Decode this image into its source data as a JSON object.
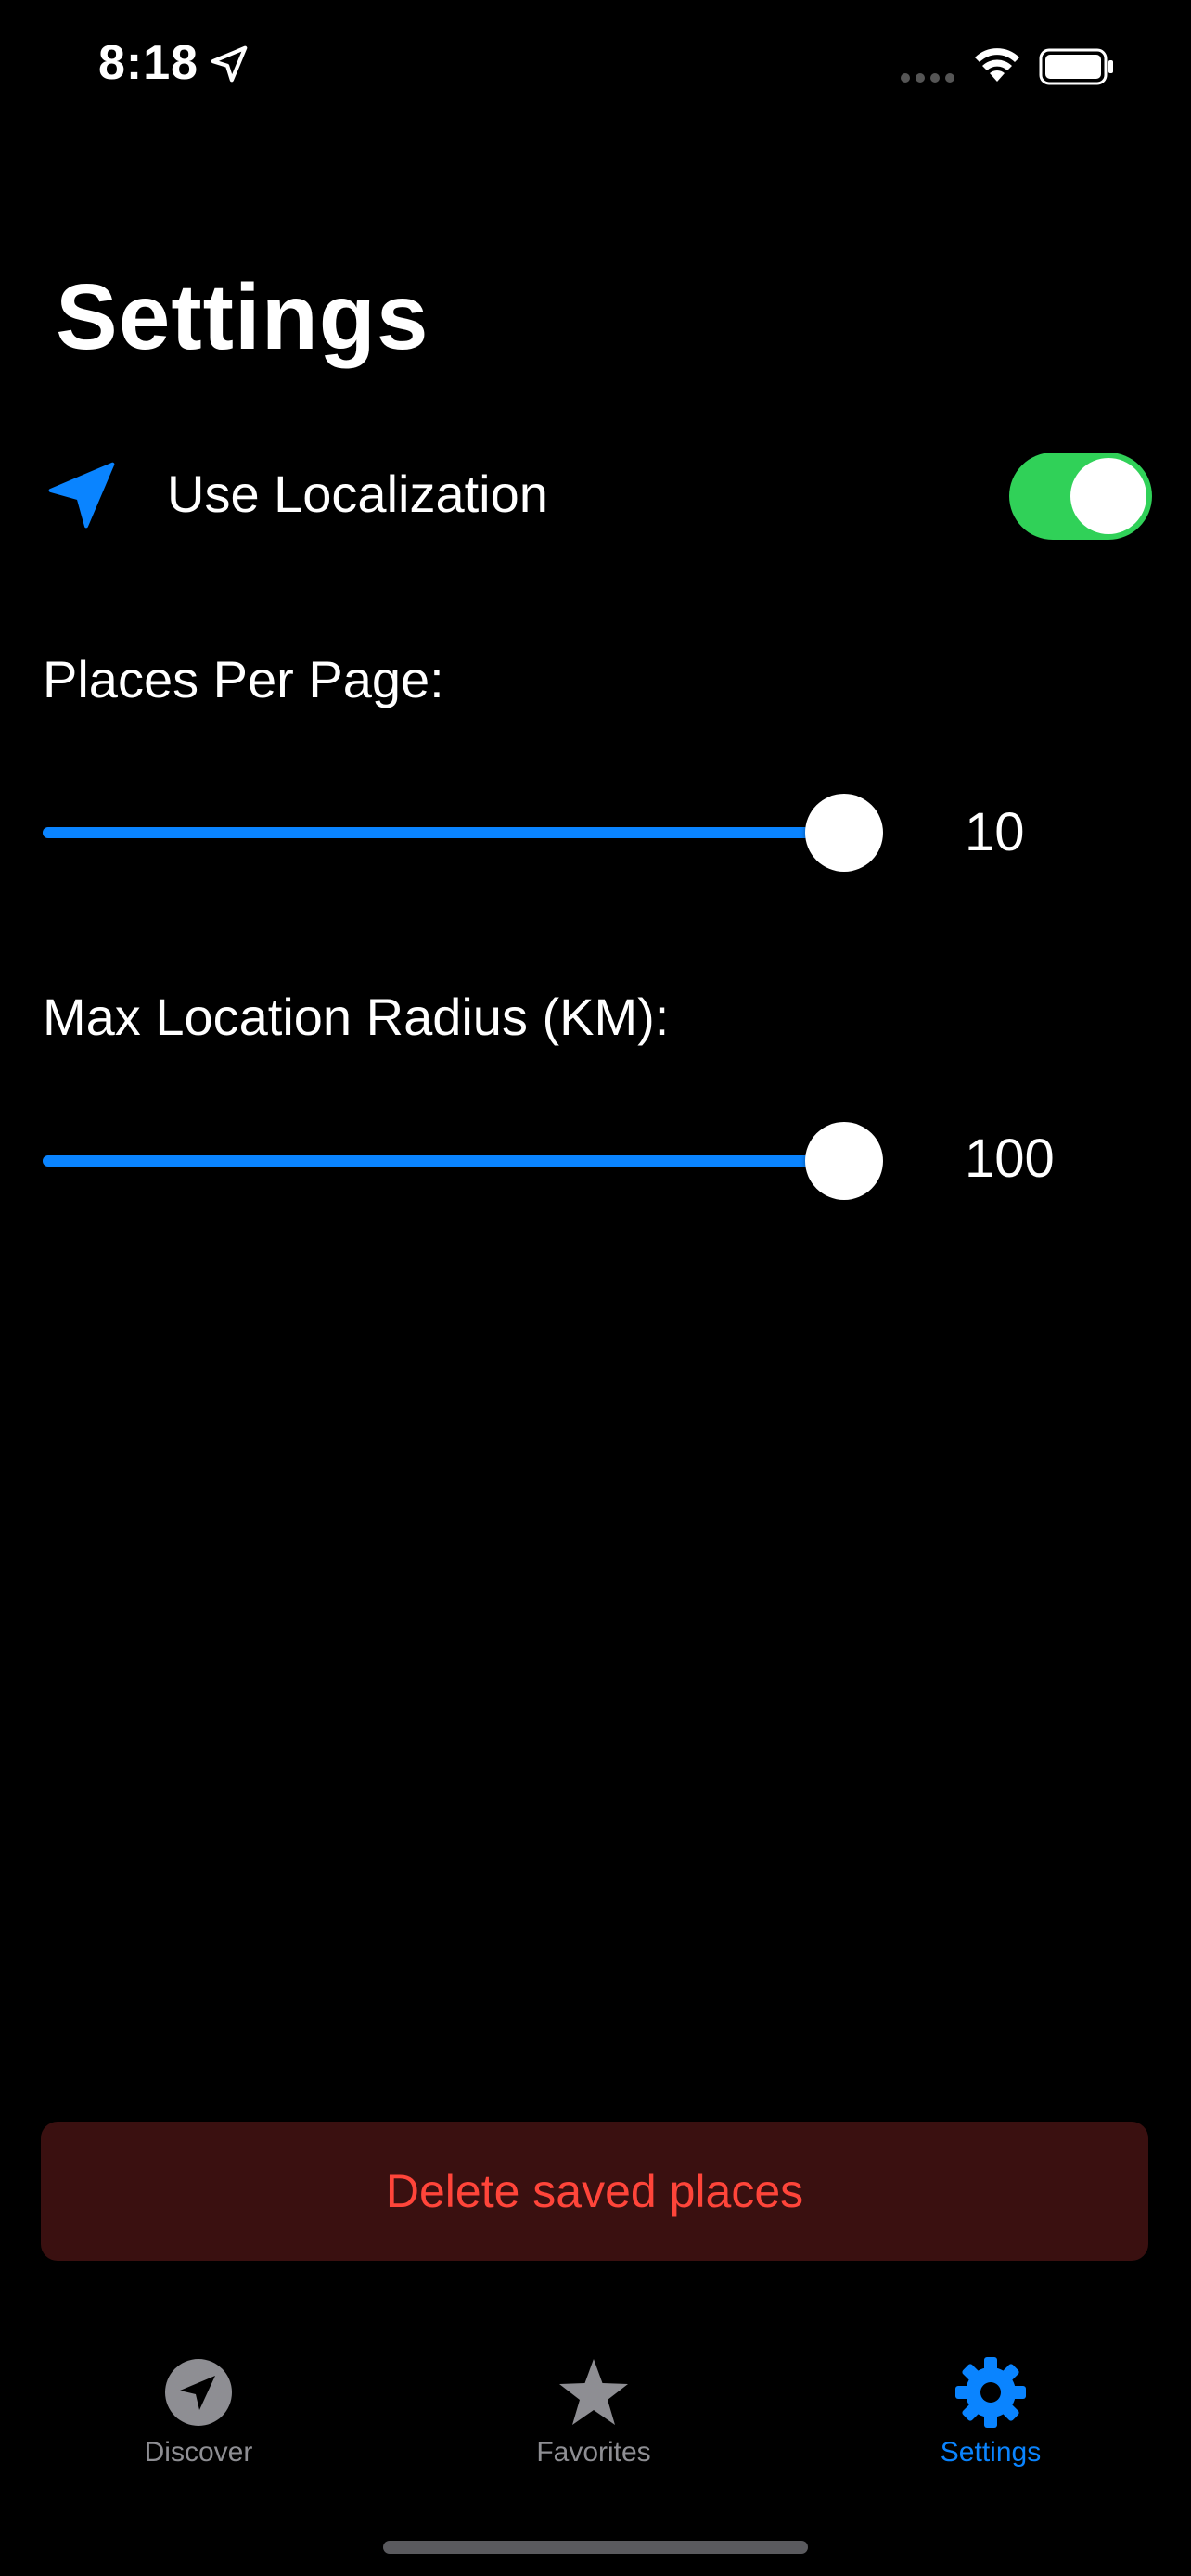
{
  "status_bar": {
    "time": "8:18",
    "location_icon": "location-arrow-outline-icon",
    "signal_icon": "cellular-dots-icon",
    "wifi_icon": "wifi-icon",
    "battery_icon": "battery-full-icon"
  },
  "page": {
    "title": "Settings"
  },
  "localization": {
    "icon": "location-arrow-fill-icon",
    "label": "Use Localization",
    "enabled": true
  },
  "places_per_page": {
    "label": "Places Per Page:",
    "value": "10",
    "fill_fraction": 0.96
  },
  "max_radius": {
    "label": "Max Location Radius (KM):",
    "value": "100",
    "fill_fraction": 0.96
  },
  "delete_button": {
    "label": "Delete saved places"
  },
  "tab_bar": {
    "tabs": [
      {
        "label": "Discover",
        "icon": "compass-navigation-icon",
        "active": false
      },
      {
        "label": "Favorites",
        "icon": "star-icon",
        "active": false
      },
      {
        "label": "Settings",
        "icon": "gear-icon",
        "active": true
      }
    ]
  },
  "colors": {
    "accent": "#0a84ff",
    "toggle_on": "#30d158",
    "destructive": "#ff453a",
    "destructive_bg": "#3a1010",
    "inactive": "#8e8e93",
    "background": "#000000"
  }
}
